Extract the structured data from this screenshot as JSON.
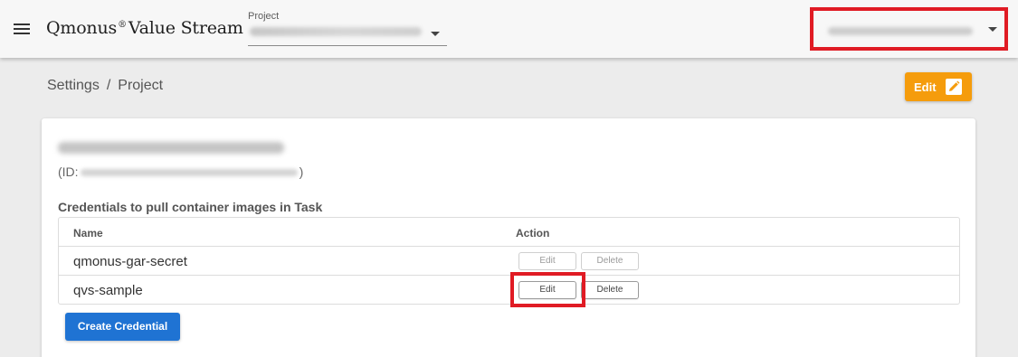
{
  "header": {
    "brand_prefix": "Qmonus",
    "brand_mark": "®",
    "brand_suffix": "Value Stream",
    "project_label": "Project",
    "menu_icon": "hamburger-menu-icon",
    "caret_icon": "caret-down-icon"
  },
  "breadcrumb": {
    "items": [
      "Settings",
      "Project"
    ],
    "separator": "/"
  },
  "edit_button": {
    "label": "Edit",
    "icon": "pencil-icon",
    "color": "#f59c0c"
  },
  "project": {
    "id_prefix": "(ID:",
    "id_suffix": ")"
  },
  "credentials": {
    "title": "Credentials to pull container images in Task",
    "columns": [
      "Name",
      "Action"
    ],
    "rows": [
      {
        "name": "qmonus-gar-secret",
        "edit_label": "Edit",
        "delete_label": "Delete"
      },
      {
        "name": "qvs-sample",
        "edit_label": "Edit",
        "delete_label": "Delete"
      }
    ],
    "create_label": "Create Credential",
    "create_color": "#1f73d3"
  },
  "annotation_color": "#e01b24"
}
